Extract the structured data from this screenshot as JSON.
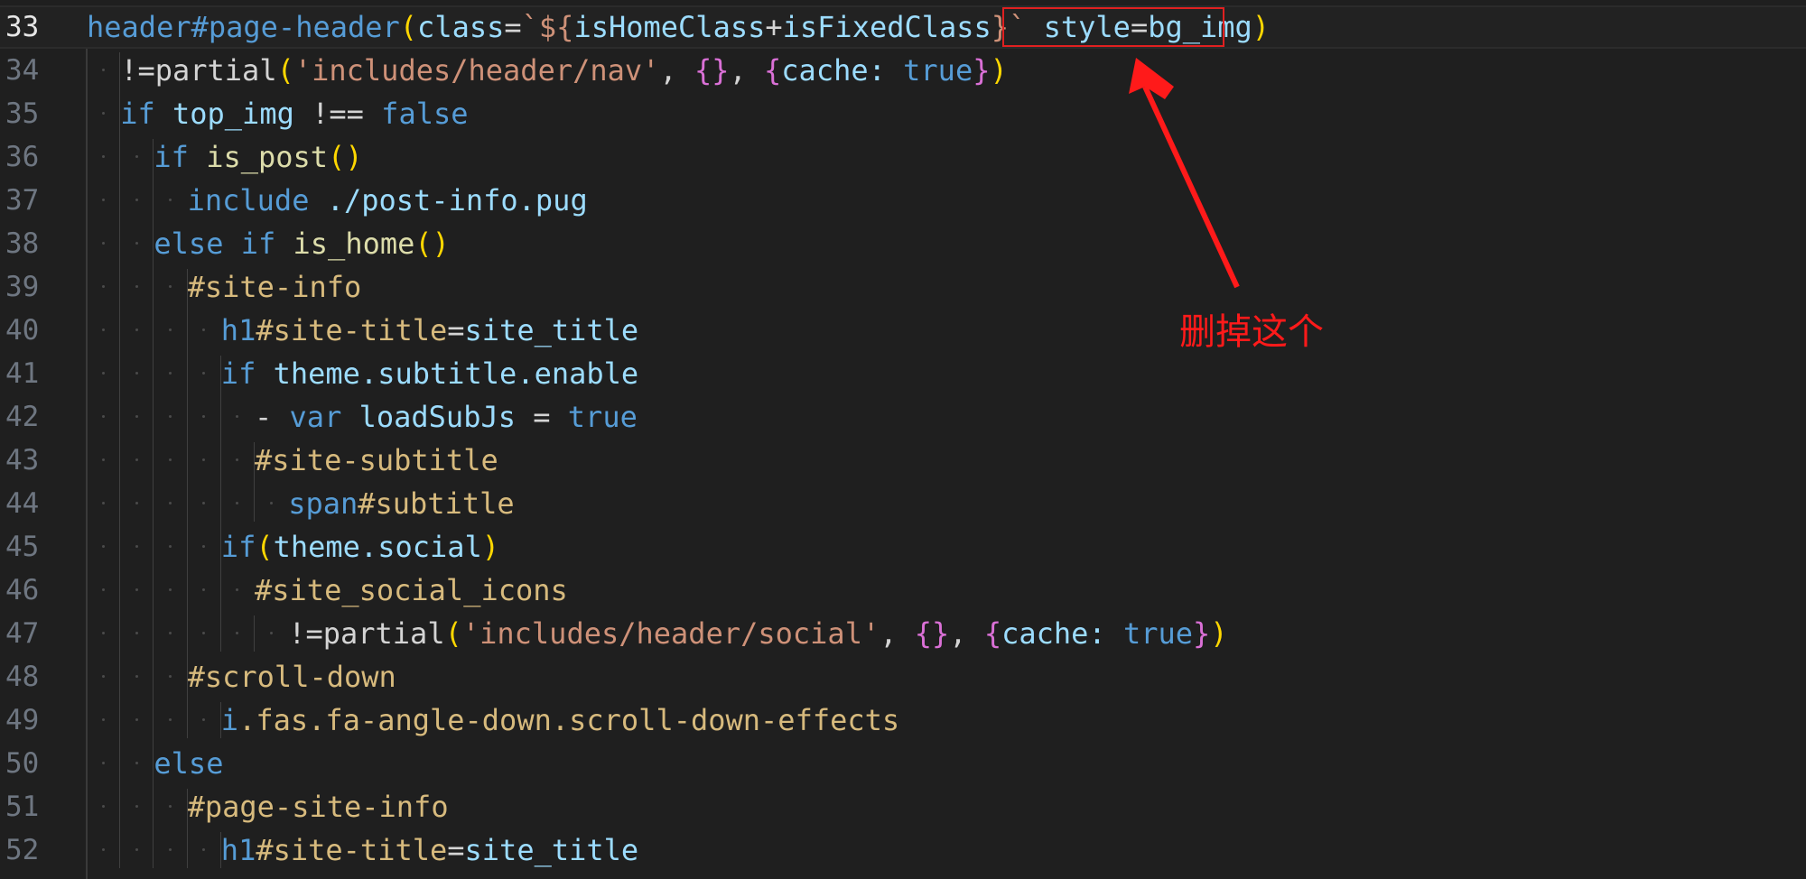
{
  "editor": {
    "lines": [
      {
        "n": "33",
        "segs": [
          [
            "header#page-header",
            "tag"
          ],
          [
            "(",
            "br1"
          ],
          [
            "class",
            "id"
          ],
          [
            "=",
            "op"
          ],
          [
            "`${",
            "str"
          ],
          [
            "isHomeClass",
            "id"
          ],
          [
            "+",
            "op"
          ],
          [
            "isFixedClass",
            "id"
          ],
          [
            "}`",
            "str"
          ],
          [
            " ",
            "pl"
          ],
          [
            "style",
            "id"
          ],
          [
            "=",
            "op"
          ],
          [
            "bg_img",
            "id"
          ],
          [
            ")",
            "br1"
          ]
        ]
      },
      {
        "n": "34",
        "segs": [
          [
            "!=partial",
            "pl"
          ],
          [
            "(",
            "br1"
          ],
          [
            "'includes/header/nav'",
            "str"
          ],
          [
            ", ",
            "pl"
          ],
          [
            "{}",
            "br2"
          ],
          [
            ", ",
            "pl"
          ],
          [
            "{",
            "br2"
          ],
          [
            "cache: ",
            "id"
          ],
          [
            "true",
            "kw"
          ],
          [
            "}",
            "br2"
          ],
          [
            ")",
            "br1"
          ]
        ]
      },
      {
        "n": "35",
        "segs": [
          [
            "if ",
            "kw"
          ],
          [
            "top_img ",
            "id"
          ],
          [
            "!== ",
            "op"
          ],
          [
            "false",
            "kw"
          ]
        ]
      },
      {
        "n": "36",
        "segs": [
          [
            "if ",
            "kw"
          ],
          [
            "is_post",
            "fn"
          ],
          [
            "()",
            "br1"
          ]
        ]
      },
      {
        "n": "37",
        "segs": [
          [
            "include ",
            "kw"
          ],
          [
            "./post-info.pug",
            "id"
          ]
        ]
      },
      {
        "n": "38",
        "segs": [
          [
            "else ",
            "kw"
          ],
          [
            "if ",
            "kw"
          ],
          [
            "is_home",
            "fn"
          ],
          [
            "()",
            "br1"
          ]
        ]
      },
      {
        "n": "39",
        "segs": [
          [
            "#site-info",
            "sel"
          ]
        ]
      },
      {
        "n": "40",
        "segs": [
          [
            "h1",
            "tag"
          ],
          [
            "#site-title",
            "sel"
          ],
          [
            "=",
            "op"
          ],
          [
            "site_title",
            "id"
          ]
        ]
      },
      {
        "n": "41",
        "segs": [
          [
            "if ",
            "kw"
          ],
          [
            "theme.subtitle.enable",
            "id"
          ]
        ]
      },
      {
        "n": "42",
        "segs": [
          [
            "- ",
            "op"
          ],
          [
            "var ",
            "kw"
          ],
          [
            "loadSubJs ",
            "id"
          ],
          [
            "= ",
            "op"
          ],
          [
            "true",
            "kw"
          ]
        ]
      },
      {
        "n": "43",
        "segs": [
          [
            "#site-subtitle",
            "sel"
          ]
        ]
      },
      {
        "n": "44",
        "segs": [
          [
            "span",
            "tag"
          ],
          [
            "#subtitle",
            "sel"
          ]
        ]
      },
      {
        "n": "45",
        "segs": [
          [
            "if",
            "kw"
          ],
          [
            "(",
            "br1"
          ],
          [
            "theme.social",
            "id"
          ],
          [
            ")",
            "br1"
          ]
        ]
      },
      {
        "n": "46",
        "segs": [
          [
            "#site_social_icons",
            "sel"
          ]
        ]
      },
      {
        "n": "47",
        "segs": [
          [
            "!=partial",
            "pl"
          ],
          [
            "(",
            "br1"
          ],
          [
            "'includes/header/social'",
            "str"
          ],
          [
            ", ",
            "pl"
          ],
          [
            "{}",
            "br2"
          ],
          [
            ", ",
            "pl"
          ],
          [
            "{",
            "br2"
          ],
          [
            "cache: ",
            "id"
          ],
          [
            "true",
            "kw"
          ],
          [
            "}",
            "br2"
          ],
          [
            ")",
            "br1"
          ]
        ]
      },
      {
        "n": "48",
        "segs": [
          [
            "#scroll-down",
            "sel"
          ]
        ]
      },
      {
        "n": "49",
        "segs": [
          [
            "i",
            "tag"
          ],
          [
            ".fas.fa-angle-down.scroll-down-effects",
            "sel"
          ]
        ]
      },
      {
        "n": "50",
        "segs": [
          [
            "else",
            "kw"
          ]
        ]
      },
      {
        "n": "51",
        "segs": [
          [
            "#page-site-info",
            "sel"
          ]
        ]
      },
      {
        "n": "52",
        "segs": [
          [
            "h1",
            "tag"
          ],
          [
            "#site-title",
            "sel"
          ],
          [
            "=",
            "op"
          ],
          [
            "site_title",
            "id"
          ]
        ]
      }
    ]
  },
  "annotation": {
    "label": "删掉这个"
  },
  "colors": {
    "annotation_red": "#ff1a1a",
    "background": "#1f1f1f"
  }
}
